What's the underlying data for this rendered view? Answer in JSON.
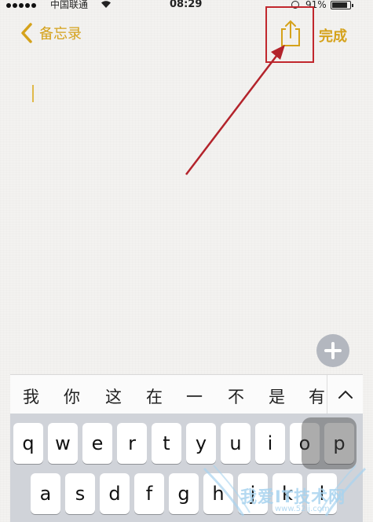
{
  "status_bar": {
    "carrier": "中国联通",
    "time": "08:29",
    "battery": "91%"
  },
  "nav": {
    "back_label": "备忘录",
    "done_label": "完成"
  },
  "suggestions": [
    "我",
    "你",
    "这",
    "在",
    "一",
    "不",
    "是",
    "有"
  ],
  "keyboard": {
    "row1": [
      "q",
      "w",
      "e",
      "r",
      "t",
      "y",
      "u",
      "i",
      "o",
      "p"
    ],
    "row2": [
      "a",
      "s",
      "d",
      "f",
      "g",
      "h",
      "j",
      "k",
      "l"
    ]
  },
  "watermark": {
    "text": "我爱IT技术网",
    "sub": "www.52ij.com"
  },
  "colors": {
    "accent": "#d5a21b",
    "annotation": "#c1272d",
    "keyboard_bg": "#d0d3d9"
  }
}
